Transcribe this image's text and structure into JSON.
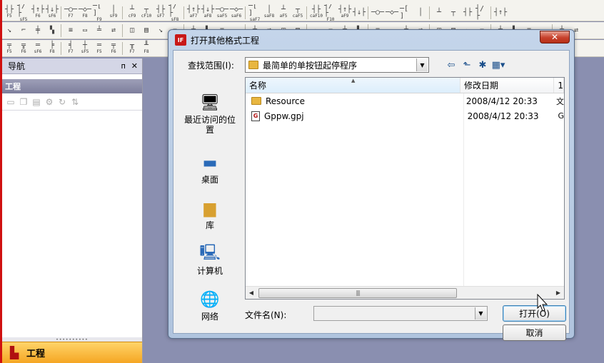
{
  "toolbar1": {
    "buttons": [
      "F5",
      "sF5",
      "F6",
      "sF6",
      "F7",
      "F8",
      "F9",
      "sF9",
      "cF9",
      "cF10",
      "sF7",
      "sF8",
      "aF7",
      "aF8",
      "saF5",
      "saF6",
      "saF7",
      "saF8",
      "aF5",
      "caF5",
      "caF10",
      "F10",
      "aF9",
      "",
      "",
      "",
      "",
      "",
      "",
      "",
      "",
      "",
      ""
    ]
  },
  "toolbar3": {
    "buttons": [
      "F5",
      "F6",
      "sF6",
      "F8",
      "F7",
      "sF5",
      "F5",
      "F6",
      "F7",
      "F8"
    ]
  },
  "nav": {
    "title": "导航",
    "pin": "ᴨ",
    "close": "✕",
    "section_label": "工程",
    "footer_label": "工程"
  },
  "dialog": {
    "app_icon_text": "IF",
    "title": "打开其他格式工程",
    "close": "✕",
    "look_in_label": "查找范围(I):",
    "look_in_value": "最简单的单按钮起停程序",
    "places": [
      {
        "label": "最近访问的位置",
        "icon": "recent-places-icon"
      },
      {
        "label": "桌面",
        "icon": "desktop-icon"
      },
      {
        "label": "库",
        "icon": "libraries-icon"
      },
      {
        "label": "计算机",
        "icon": "computer-icon"
      },
      {
        "label": "网络",
        "icon": "network-icon"
      }
    ],
    "columns": {
      "name": "名称",
      "date": "修改日期",
      "rest": "1"
    },
    "files": [
      {
        "name": "Resource",
        "date": "2008/4/12 20:33",
        "rest": "文",
        "type": "folder"
      },
      {
        "name": "Gppw.gpj",
        "date": "2008/4/12 20:33",
        "rest": "G",
        "type": "file"
      }
    ],
    "filename_label": "文件名(N):",
    "filename_value": "",
    "open_button": "打开(O)",
    "cancel_button": "取消"
  }
}
